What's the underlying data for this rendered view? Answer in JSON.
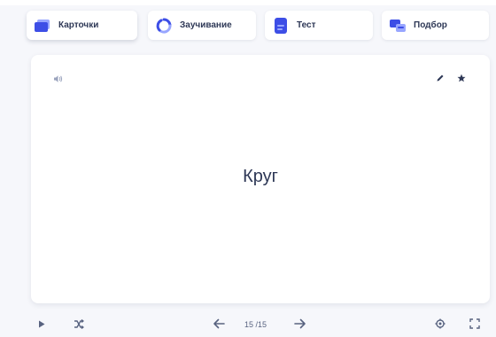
{
  "modes": [
    {
      "label": "Карточки",
      "icon": "cards-icon",
      "active": true
    },
    {
      "label": "Заучивание",
      "icon": "learn-cycle-icon",
      "active": false
    },
    {
      "label": "Тест",
      "icon": "test-document-icon",
      "active": false
    },
    {
      "label": "Подбор",
      "icon": "match-icon",
      "active": false
    }
  ],
  "card": {
    "term": "Круг",
    "icons": [
      "audio-icon",
      "edit-pencil-icon",
      "star-icon"
    ]
  },
  "controls": {
    "counter": "15 /15",
    "icons": [
      "play-icon",
      "shuffle-icon",
      "arrow-left-icon",
      "arrow-right-icon",
      "settings-icon",
      "fullscreen-icon"
    ]
  },
  "colors": {
    "accent": "#4255ff",
    "text": "#2e3856",
    "muted": "#586380",
    "background": "#f6f7fb",
    "card": "#ffffff"
  }
}
